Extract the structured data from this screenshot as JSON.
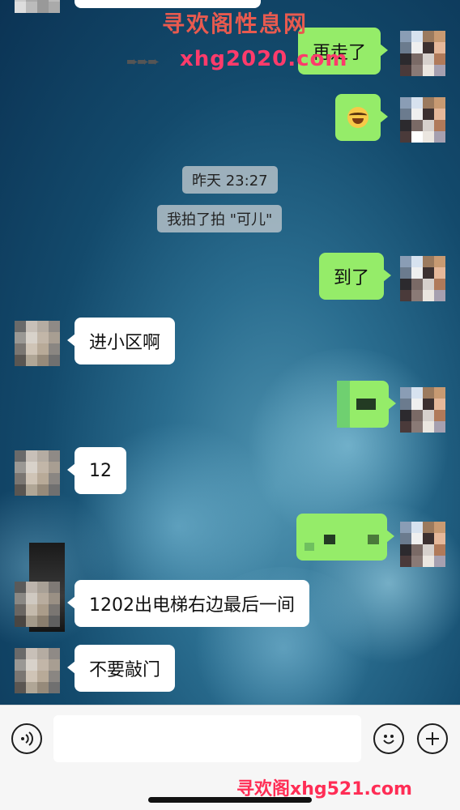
{
  "watermarks": {
    "top_title": "寻欢阁性息网",
    "top_url": "xhg2020.com",
    "arrow": "➨➨➨",
    "bottom": "寻欢阁xhg521.com"
  },
  "messages": [
    {
      "side": "right",
      "text": "再走了"
    },
    {
      "side": "right",
      "type": "emoji",
      "emoji": "face-with-tears-of-joy"
    },
    {
      "side": "system",
      "text": "昨天 23:27"
    },
    {
      "side": "system",
      "text": "我拍了拍 \"可儿\""
    },
    {
      "side": "right",
      "text": "到了"
    },
    {
      "side": "left",
      "text": "进小区啊"
    },
    {
      "side": "right",
      "type": "censored"
    },
    {
      "side": "left",
      "text": "12"
    },
    {
      "side": "right",
      "type": "censored"
    },
    {
      "side": "left",
      "text": "1202出电梯右边最后一间"
    },
    {
      "side": "left",
      "text": "不要敲门"
    }
  ],
  "input_bar": {
    "voice_icon": "voice-icon",
    "emoji_icon": "emoji-icon",
    "plus_icon": "plus-icon",
    "input_value": ""
  },
  "colors": {
    "bubble_right": "#95ec69",
    "bubble_left": "#ffffff",
    "system_bg": "#c8cdd2"
  }
}
